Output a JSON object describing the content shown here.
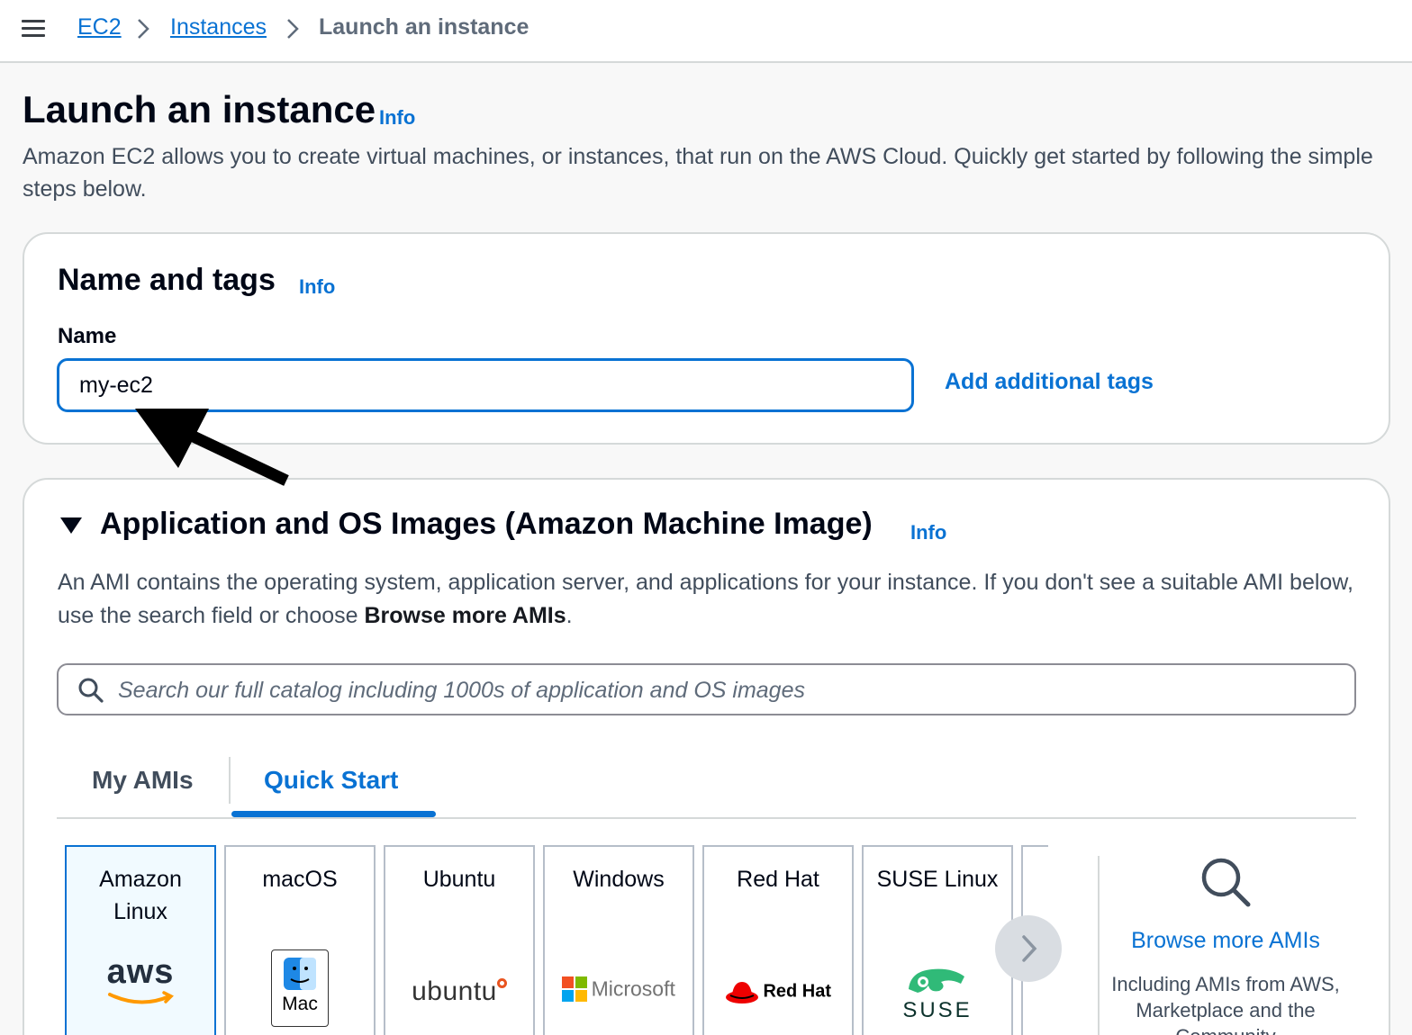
{
  "breadcrumb": {
    "items": [
      "EC2",
      "Instances"
    ],
    "current": "Launch an instance"
  },
  "page": {
    "title": "Launch an instance",
    "info": "Info",
    "description": "Amazon EC2 allows you to create virtual machines, or instances, that run on the AWS Cloud. Quickly get started by following the simple steps below."
  },
  "name_tags": {
    "heading": "Name and tags",
    "info": "Info",
    "name_label": "Name",
    "name_value": "my-ec2",
    "add_tags": "Add additional tags"
  },
  "ami": {
    "heading": "Application and OS Images (Amazon Machine Image)",
    "info": "Info",
    "desc_pre": "An AMI contains the operating system, application server, and applications for your instance. If you don't see a suitable AMI below, use the search field or choose ",
    "desc_bold": "Browse more AMIs",
    "desc_post": ".",
    "search_placeholder": "Search our full catalog including 1000s of application and OS images",
    "tabs": [
      "My AMIs",
      "Quick Start"
    ],
    "active_tab": "Quick Start",
    "tiles": [
      {
        "label_line1": "Amazon",
        "label_line2": "Linux",
        "logo_text": "aws"
      },
      {
        "label_line1": "macOS",
        "label_line2": "",
        "logo_text": "Mac"
      },
      {
        "label_line1": "Ubuntu",
        "label_line2": "",
        "logo_text": "ubuntu"
      },
      {
        "label_line1": "Windows",
        "label_line2": "",
        "logo_text": "Microsoft"
      },
      {
        "label_line1": "Red Hat",
        "label_line2": "",
        "logo_text": "Red Hat"
      },
      {
        "label_line1": "SUSE Linux",
        "label_line2": "",
        "logo_text": "SUSE"
      }
    ],
    "browse_more": "Browse more AMIs",
    "browse_sub": "Including AMIs from AWS, Marketplace and the Community"
  },
  "colors": {
    "link_blue": "#0972d3",
    "text_dark": "#000716",
    "text_secondary": "#414d5c",
    "selected_tile_bg": "#f1faff"
  },
  "icons": [
    "menu-icon",
    "chevron-right-icon",
    "search-icon",
    "caret-down-icon",
    "mac-finder-icon",
    "microsoft-logo-icon",
    "redhat-logo-icon",
    "suse-logo-icon",
    "aws-logo-icon",
    "annotation-arrow-icon"
  ]
}
